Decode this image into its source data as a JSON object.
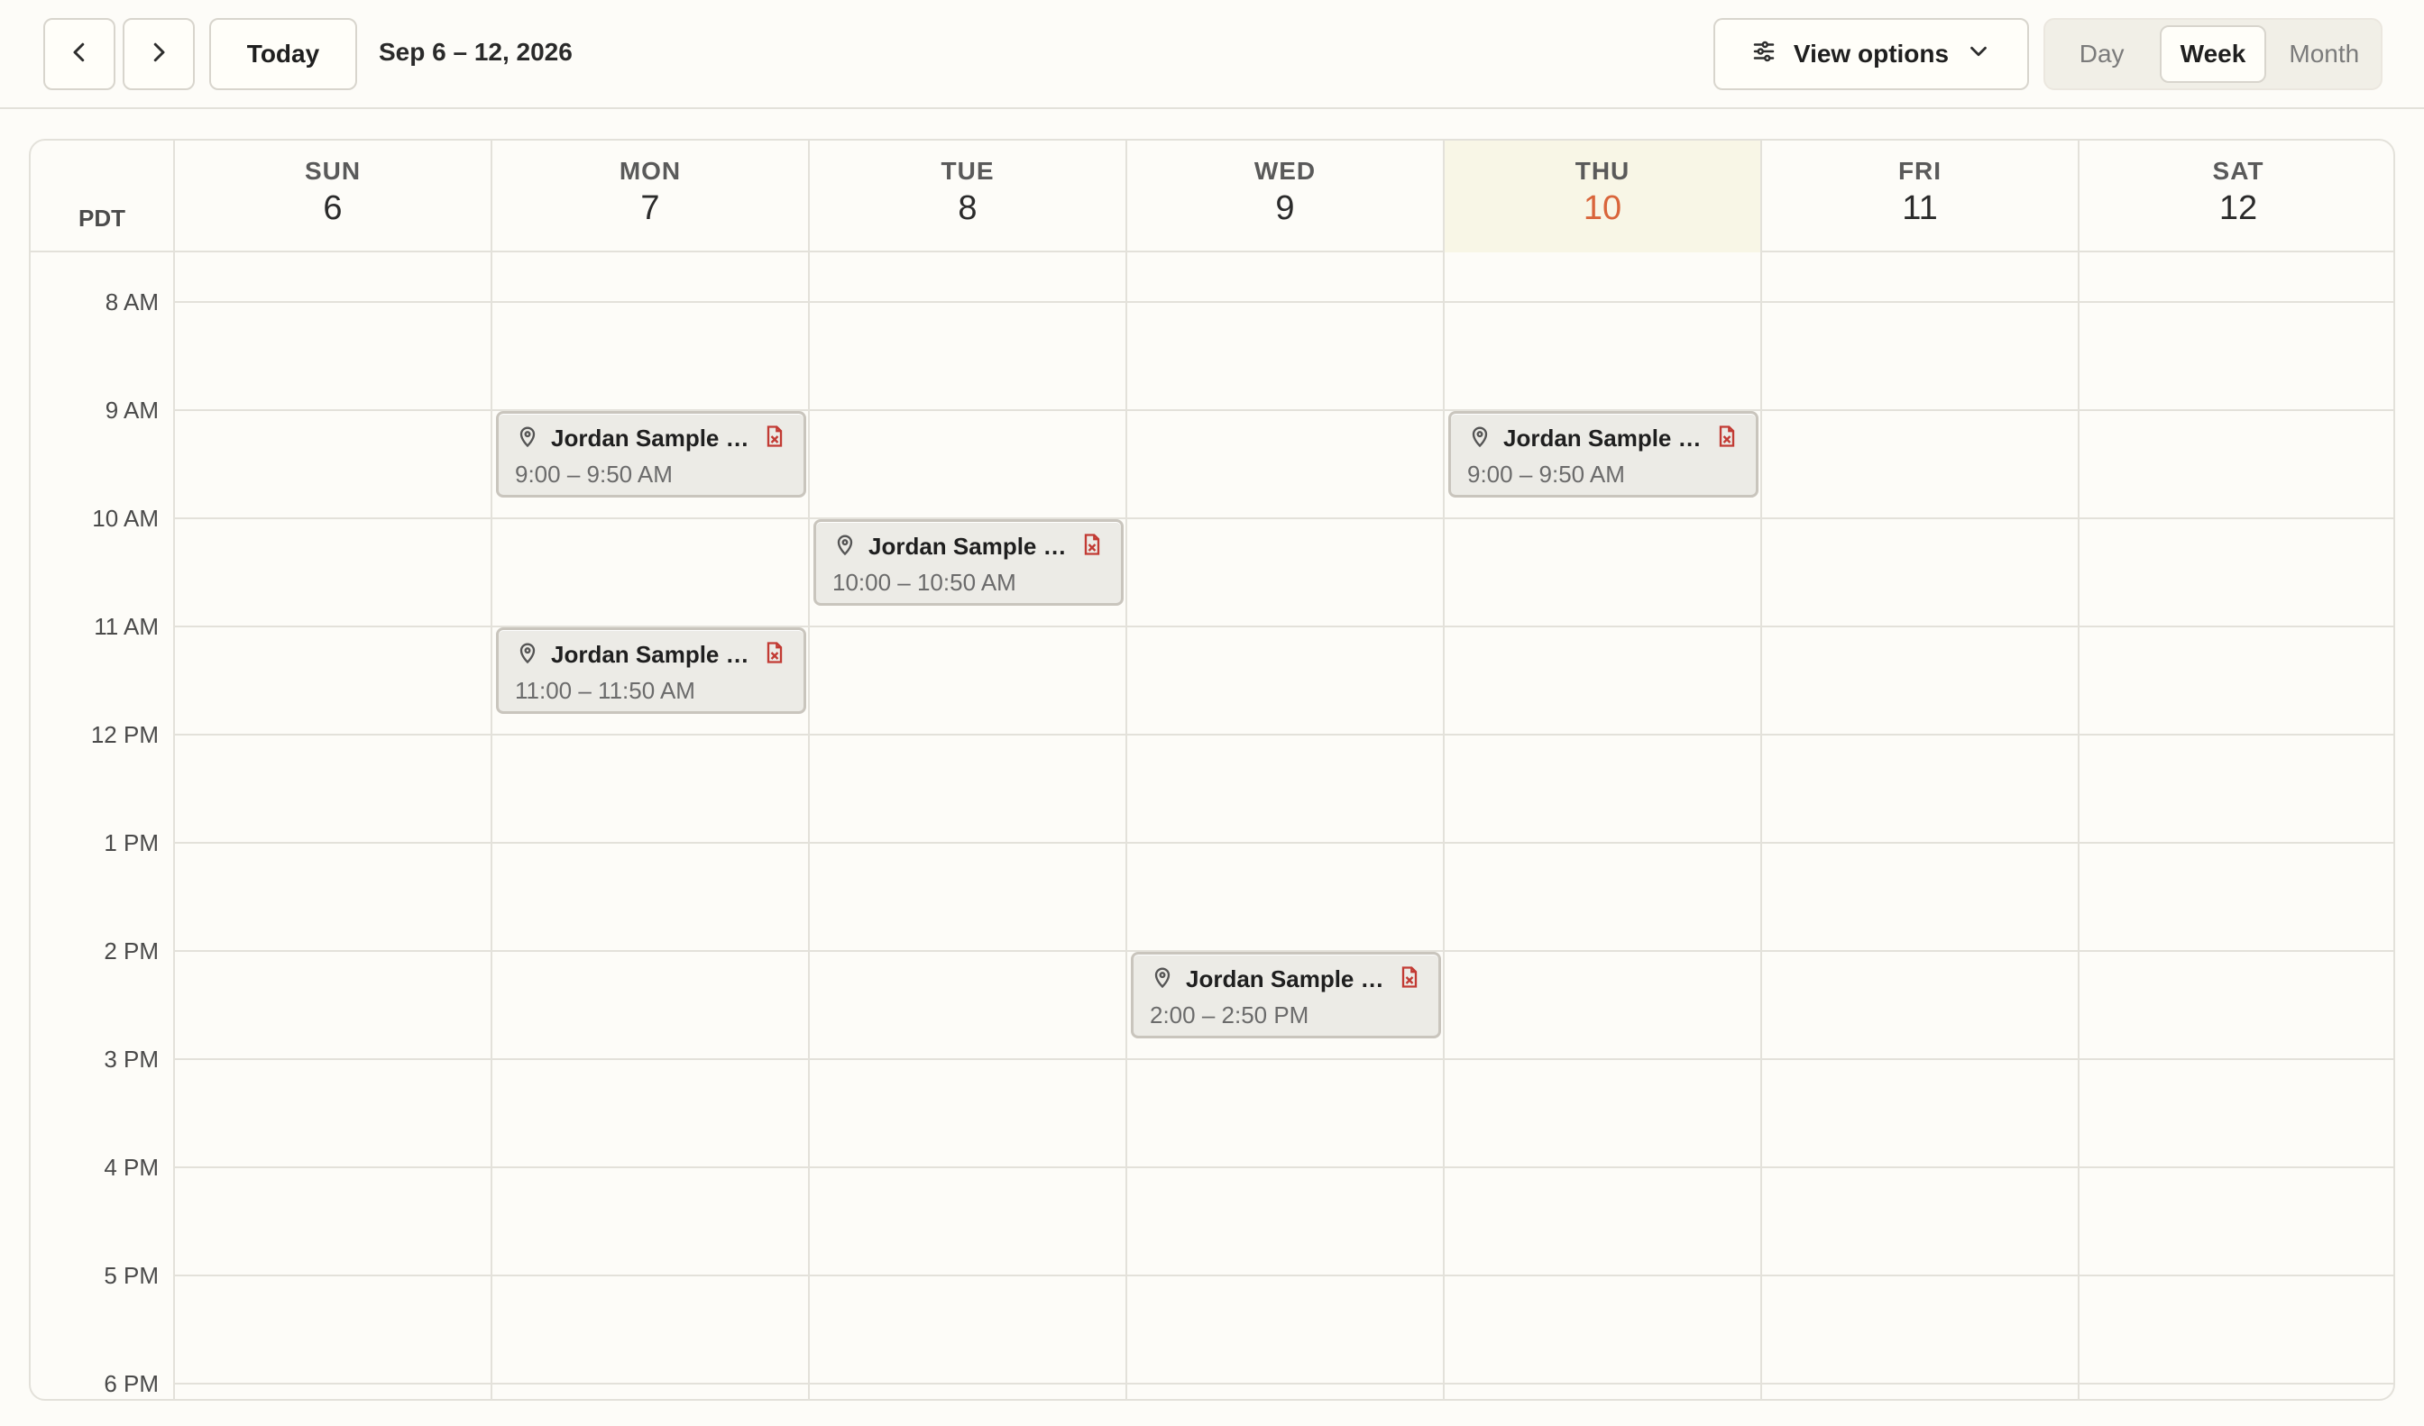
{
  "toolbar": {
    "prev_icon": "chevron-left-icon",
    "next_icon": "chevron-right-icon",
    "today_label": "Today",
    "date_range": "Sep 6 – 12, 2026",
    "view_options_label": "View options",
    "view_modes": [
      "Day",
      "Week",
      "Month"
    ],
    "active_view": "Week"
  },
  "calendar": {
    "timezone": "PDT",
    "days": [
      {
        "name": "SUN",
        "date": "6"
      },
      {
        "name": "MON",
        "date": "7"
      },
      {
        "name": "TUE",
        "date": "8"
      },
      {
        "name": "WED",
        "date": "9"
      },
      {
        "name": "THU",
        "date": "10",
        "today": true
      },
      {
        "name": "FRI",
        "date": "11"
      },
      {
        "name": "SAT",
        "date": "12"
      }
    ],
    "times": [
      "8 AM",
      "9 AM",
      "10 AM",
      "11 AM",
      "12 PM",
      "1 PM",
      "2 PM",
      "3 PM",
      "4 PM",
      "5 PM",
      "6 PM"
    ],
    "events": [
      {
        "day": 1,
        "title": "Jordan Sample (d...",
        "time": "9:00 – 9:50 AM"
      },
      {
        "day": 1,
        "title": "Jordan Sample (d...",
        "time": "11:00 – 11:50 AM"
      },
      {
        "day": 2,
        "title": "Jordan Sample (d...",
        "time": "10:00 – 10:50 AM"
      },
      {
        "day": 3,
        "title": "Jordan Sample (d...",
        "time": "2:00 – 2:50 PM"
      },
      {
        "day": 4,
        "title": "Jordan Sample (d...",
        "time": "9:00 – 9:50 AM"
      }
    ]
  },
  "colors": {
    "accent": "#d9653b",
    "today_bg": "#f8f6e6",
    "event_bg": "#ecebe6"
  }
}
